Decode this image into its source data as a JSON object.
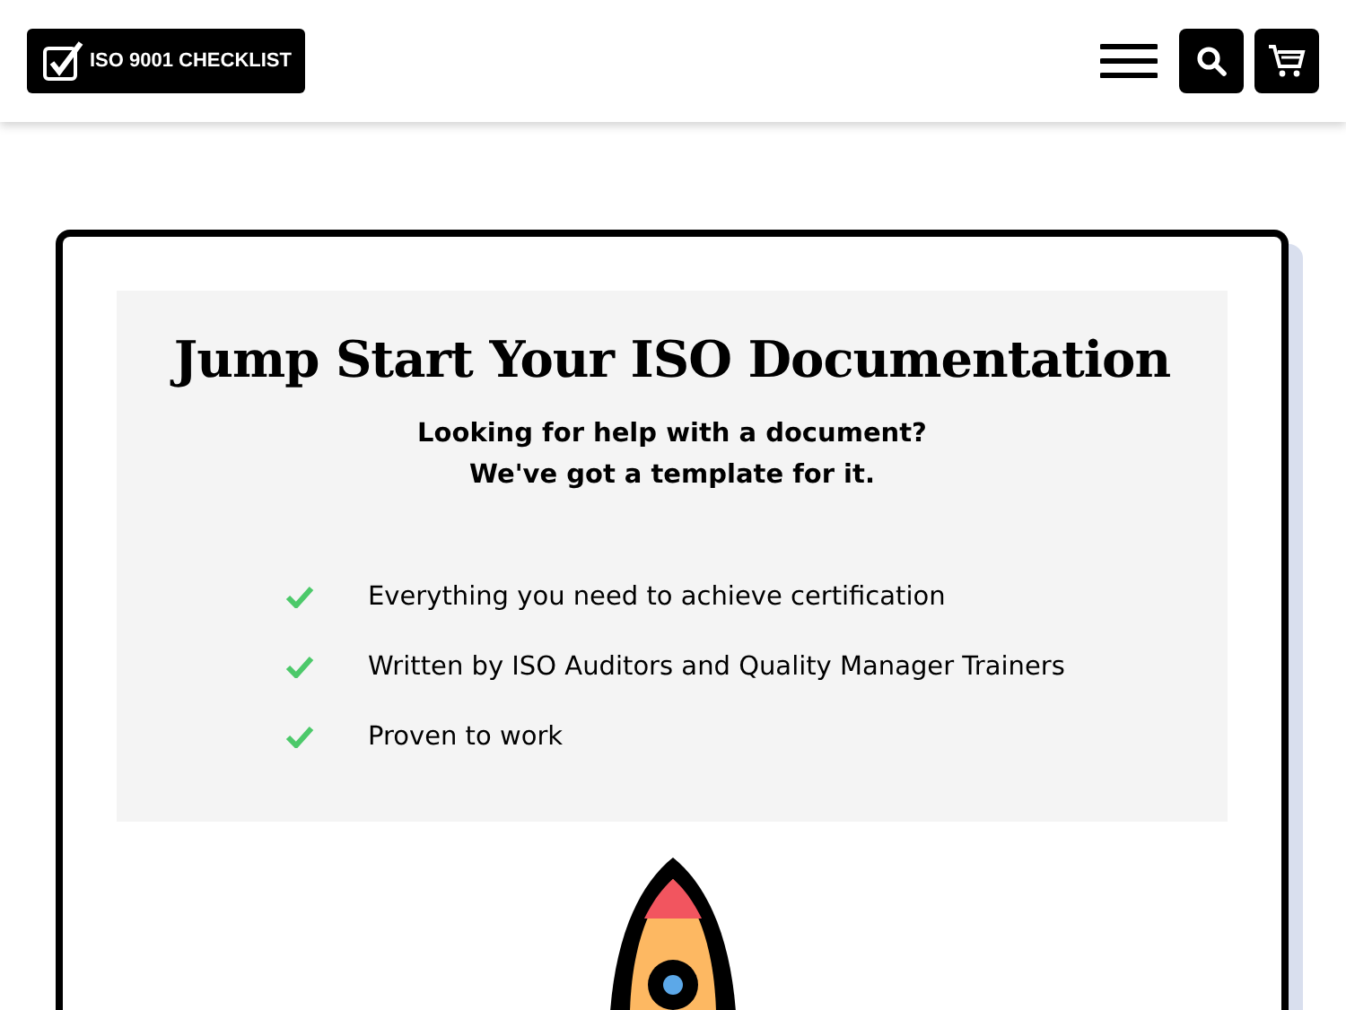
{
  "header": {
    "logo": "ISO 9001 CHECKLIST"
  },
  "hero": {
    "title": "Jump Start Your ISO Documentation",
    "subtitle_lines": [
      "Looking for help with a document?",
      "We've got a template for it."
    ],
    "features": [
      "Everything you need to achieve certification",
      "Written by ISO Auditors and Quality Manager Trainers",
      "Proven to work"
    ]
  }
}
